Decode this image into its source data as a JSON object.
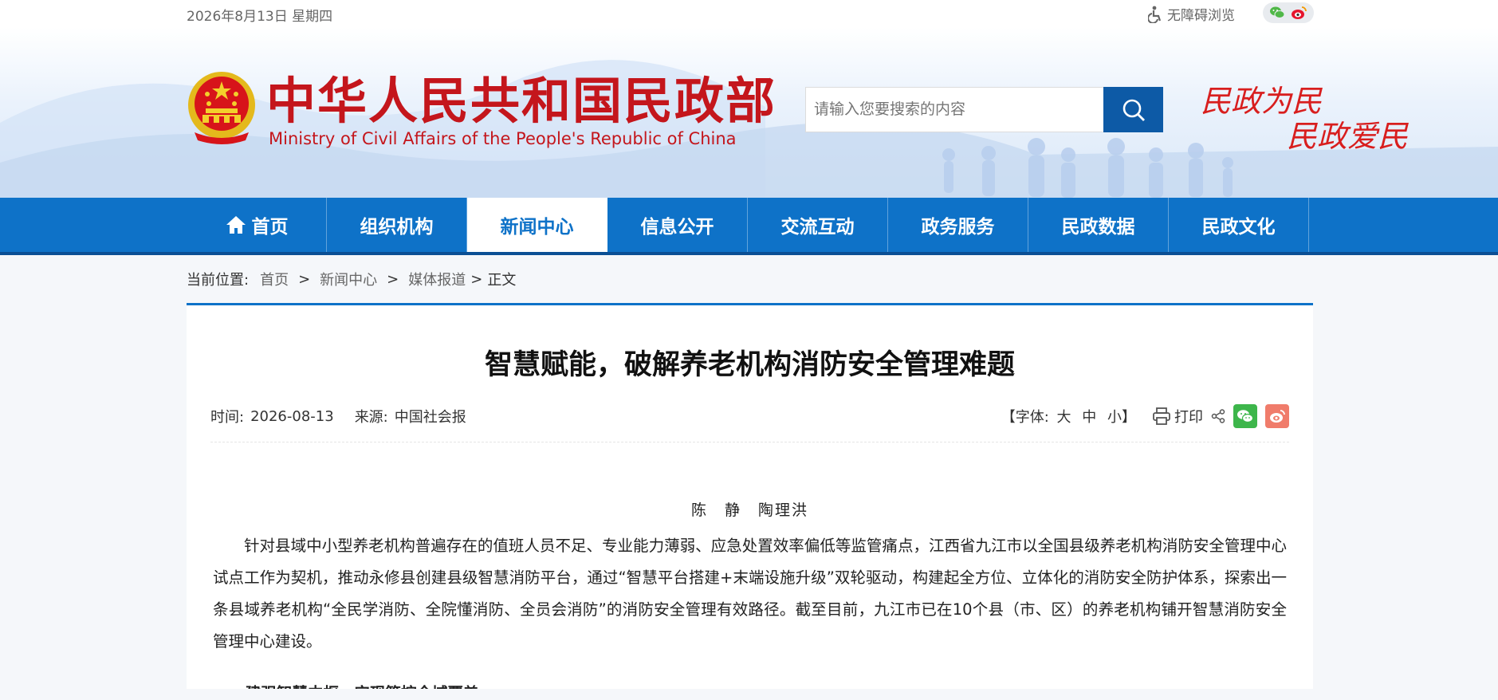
{
  "topbar": {
    "date": "2026年8月13日 星期四",
    "accessibility_label": "无障碍浏览",
    "accessibility_icon": "wheelchair-icon"
  },
  "header": {
    "title_cn": "中华人民共和国民政部",
    "title_en": "Ministry of Civil Affairs of the People's Republic of China",
    "search_placeholder": "请输入您要搜索的内容",
    "slogan_line1": "民政为民",
    "slogan_line2": "民政爱民",
    "brand_red": "#c4161c",
    "nav_blue": "#0e72c8"
  },
  "nav": {
    "items": [
      "首页",
      "组织机构",
      "新闻中心",
      "信息公开",
      "交流互动",
      "政务服务",
      "民政数据",
      "民政文化"
    ],
    "active": "新闻中心"
  },
  "breadcrumb": {
    "label": "当前位置:",
    "items": [
      "首页",
      "新闻中心",
      "媒体报道"
    ],
    "current": "正文",
    "sep": ">"
  },
  "article": {
    "title": "智慧赋能，破解养老机构消防安全管理难题",
    "time_label": "时间:",
    "time": "2026-08-13",
    "source_label": "来源:",
    "source": "中国社会报",
    "font_label": "【字体:",
    "font_large": "大",
    "font_medium": "中",
    "font_small": "小】",
    "print_label": "打印",
    "author": "陈　静　陶理洪",
    "paragraph": "针对县域中小型养老机构普遍存在的值班人员不足、专业能力薄弱、应急处置效率偏低等监管痛点，江西省九江市以全国县级养老机构消防安全管理中心试点工作为契机，推动永修县创建县级智慧消防平台，通过“智慧平台搭建+末端设施升级”双轮驱动，构建起全方位、立体化的消防安全防护体系，探索出一条县域养老机构“全民学消防、全院懂消防、全员会消防”的消防安全管理有效路径。截至目前，九江市已在10个县（市、区）的养老机构铺开智慧消防安全管理中心建设。",
    "subheading": "建强智慧中枢，实现管控全域覆盖"
  }
}
